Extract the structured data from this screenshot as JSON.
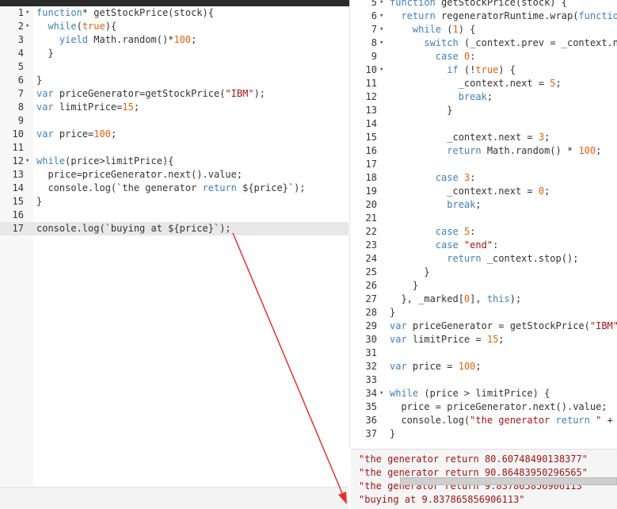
{
  "left_editor": {
    "lines": [
      {
        "n": "1",
        "fold": "▾",
        "code": "function* getStockPrice(stock){"
      },
      {
        "n": "2",
        "fold": "▾",
        "code": "  while(true){"
      },
      {
        "n": "3",
        "fold": "",
        "code": "    yield Math.random()*100;"
      },
      {
        "n": "4",
        "fold": "",
        "code": "  }"
      },
      {
        "n": "5",
        "fold": "",
        "code": ""
      },
      {
        "n": "6",
        "fold": "",
        "code": "}"
      },
      {
        "n": "7",
        "fold": "",
        "code": "var priceGenerator=getStockPrice(\"IBM\");"
      },
      {
        "n": "8",
        "fold": "",
        "code": "var limitPrice=15;"
      },
      {
        "n": "9",
        "fold": "",
        "code": ""
      },
      {
        "n": "10",
        "fold": "",
        "code": "var price=100;"
      },
      {
        "n": "11",
        "fold": "",
        "code": ""
      },
      {
        "n": "12",
        "fold": "▾",
        "code": "while(price>limitPrice){"
      },
      {
        "n": "13",
        "fold": "",
        "code": "  price=priceGenerator.next().value;"
      },
      {
        "n": "14",
        "fold": "",
        "code": "  console.log(`the generator return ${price}`);"
      },
      {
        "n": "15",
        "fold": "",
        "code": "}"
      },
      {
        "n": "16",
        "fold": "",
        "code": ""
      },
      {
        "n": "17",
        "fold": "",
        "code": "console.log(`buying at ${price}`);"
      }
    ],
    "active_line": "17"
  },
  "right_output": {
    "lines": [
      {
        "n": "5",
        "fold": "▾",
        "code": "function getStockPrice(stock) {"
      },
      {
        "n": "6",
        "fold": "▾",
        "code": "  return regeneratorRuntime.wrap(function ge"
      },
      {
        "n": "7",
        "fold": "▾",
        "code": "    while (1) {"
      },
      {
        "n": "8",
        "fold": "▾",
        "code": "      switch (_context.prev = _context.next)"
      },
      {
        "n": "9",
        "fold": "",
        "code": "        case 0:"
      },
      {
        "n": "10",
        "fold": "▾",
        "code": "          if (!true) {"
      },
      {
        "n": "11",
        "fold": "",
        "code": "            _context.next = 5;"
      },
      {
        "n": "12",
        "fold": "",
        "code": "            break;"
      },
      {
        "n": "13",
        "fold": "",
        "code": "          }"
      },
      {
        "n": "14",
        "fold": "",
        "code": ""
      },
      {
        "n": "15",
        "fold": "",
        "code": "          _context.next = 3;"
      },
      {
        "n": "16",
        "fold": "",
        "code": "          return Math.random() * 100;"
      },
      {
        "n": "17",
        "fold": "",
        "code": ""
      },
      {
        "n": "18",
        "fold": "",
        "code": "        case 3:"
      },
      {
        "n": "19",
        "fold": "",
        "code": "          _context.next = 0;"
      },
      {
        "n": "20",
        "fold": "",
        "code": "          break;"
      },
      {
        "n": "21",
        "fold": "",
        "code": ""
      },
      {
        "n": "22",
        "fold": "",
        "code": "        case 5:"
      },
      {
        "n": "23",
        "fold": "",
        "code": "        case \"end\":"
      },
      {
        "n": "24",
        "fold": "",
        "code": "          return _context.stop();"
      },
      {
        "n": "25",
        "fold": "",
        "code": "      }"
      },
      {
        "n": "26",
        "fold": "",
        "code": "    }"
      },
      {
        "n": "27",
        "fold": "",
        "code": "  }, _marked[0], this);"
      },
      {
        "n": "28",
        "fold": "",
        "code": "}"
      },
      {
        "n": "29",
        "fold": "",
        "code": "var priceGenerator = getStockPrice(\"IBM\");"
      },
      {
        "n": "30",
        "fold": "",
        "code": "var limitPrice = 15;"
      },
      {
        "n": "31",
        "fold": "",
        "code": ""
      },
      {
        "n": "32",
        "fold": "",
        "code": "var price = 100;"
      },
      {
        "n": "33",
        "fold": "",
        "code": ""
      },
      {
        "n": "34",
        "fold": "▾",
        "code": "while (price > limitPrice) {"
      },
      {
        "n": "35",
        "fold": "",
        "code": "  price = priceGenerator.next().value;"
      },
      {
        "n": "36",
        "fold": "",
        "code": "  console.log(\"the generator return \" + pric"
      },
      {
        "n": "37",
        "fold": "",
        "code": "}"
      }
    ]
  },
  "console": {
    "line1": "\"the generator return 80.60748490138377\"",
    "line2": "\"the generator return 90.86483950296565\"",
    "line3": "\"the generator return 9.837865856906113\"",
    "line4": "\"buying at 9.837865856906113\""
  },
  "colors": {
    "arrow": "#e8312a",
    "active_line_bg": "#e8e8e8",
    "console_text": "#a31515"
  }
}
